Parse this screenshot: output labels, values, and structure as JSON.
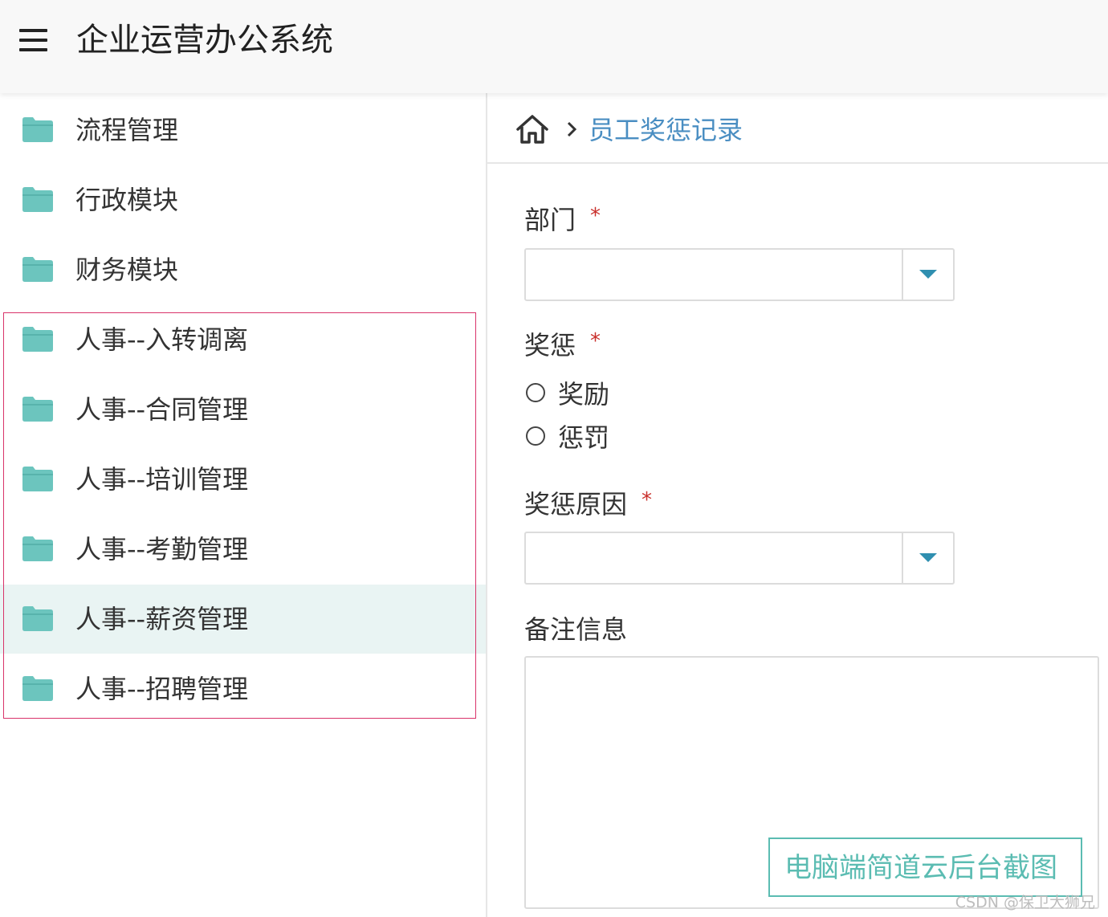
{
  "header": {
    "title": "企业运营办公系统"
  },
  "sidebar": {
    "items": [
      {
        "label": "流程管理"
      },
      {
        "label": "行政模块"
      },
      {
        "label": "财务模块"
      },
      {
        "label": "人事--入转调离"
      },
      {
        "label": "人事--合同管理"
      },
      {
        "label": "人事--培训管理"
      },
      {
        "label": "人事--考勤管理"
      },
      {
        "label": "人事--薪资管理"
      },
      {
        "label": "人事--招聘管理"
      }
    ],
    "active_index": 7
  },
  "breadcrumb": {
    "current": "员工奖惩记录"
  },
  "form": {
    "department": {
      "label": "部门",
      "required": "*",
      "value": ""
    },
    "reward_punish": {
      "label": "奖惩",
      "required": "*",
      "options": [
        "奖励",
        "惩罚"
      ]
    },
    "reason": {
      "label": "奖惩原因",
      "required": "*",
      "value": ""
    },
    "remarks": {
      "label": "备注信息",
      "value": ""
    }
  },
  "overlay": {
    "caption": "电脑端简道云后台截图",
    "credit": "CSDN @保卫大狮兄"
  },
  "colors": {
    "accent": "#5bbcb2",
    "folder": "#6cc5be",
    "breadcrumb_link": "#4a8ec2",
    "required": "#c9302c",
    "active_bg": "#e9f4f3",
    "highlight_border": "#d9336a"
  }
}
